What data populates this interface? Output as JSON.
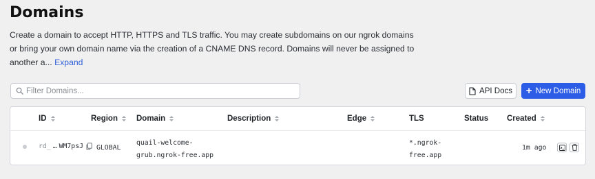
{
  "header": {
    "title": "Domains",
    "description": "Create a domain to accept HTTP, HTTPS and TLS traffic. You may create subdomains on our ngrok domains or bring your own domain name via the creation of a CNAME DNS record. Domains will never be assigned to another a...",
    "expand_label": "Expand"
  },
  "toolbar": {
    "filter_placeholder": "Filter Domains...",
    "api_docs_label": "API Docs",
    "new_domain_label": "New Domain"
  },
  "colors": {
    "primary": "#2d5ce6",
    "link": "#2f5fd8",
    "background": "#f0f0f1"
  },
  "table": {
    "columns": {
      "id": "ID",
      "region": "Region",
      "domain": "Domain",
      "description": "Description",
      "edge": "Edge",
      "tls": "TLS",
      "status": "Status",
      "created": "Created"
    },
    "rows": [
      {
        "id_prefix": "rd_",
        "id_suffix": "WM7psJ",
        "region": "GLOBAL",
        "domain_line1": "quail-welcome-",
        "domain_line2": "grub.ngrok-free.app",
        "description": "",
        "edge": "",
        "tls_line1": "*.ngrok-",
        "tls_line2": "free.app",
        "status": "",
        "created": "1m ago"
      }
    ]
  }
}
